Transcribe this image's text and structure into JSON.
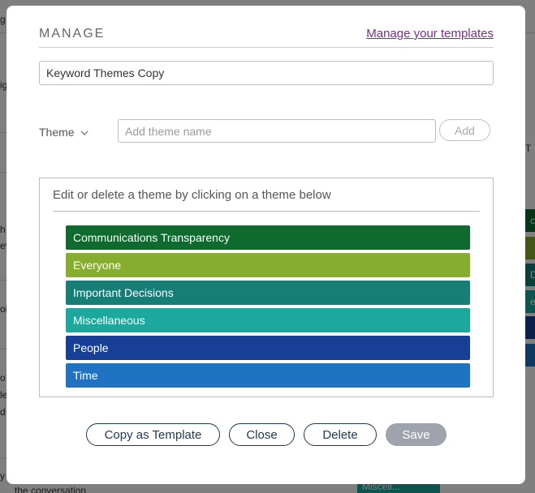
{
  "modal": {
    "title": "MANAGE",
    "manage_link": "Manage your templates",
    "template_name_value": "Keyword Themes Copy",
    "theme_label": "Theme",
    "theme_name_placeholder": "Add theme name",
    "add_label": "Add",
    "themes_instruction": "Edit or delete a theme by clicking on a theme below",
    "themes": [
      {
        "name": "Communications Transparency",
        "color": "#0e6a2f"
      },
      {
        "name": "Everyone",
        "color": "#86ad2e"
      },
      {
        "name": "Important Decisions",
        "color": "#177e76"
      },
      {
        "name": "Miscellaneous",
        "color": "#1ca89d"
      },
      {
        "name": "People",
        "color": "#173f95"
      },
      {
        "name": "Time",
        "color": "#1f73c0"
      }
    ],
    "buttons": {
      "copy_as_template": "Copy as Template",
      "close": "Close",
      "delete": "Delete",
      "save": "Save"
    }
  },
  "background": {
    "texts": [
      "g",
      "ig",
      "h",
      "ev",
      "oi",
      "o",
      "le",
      "d",
      "y",
      "the conversation",
      "ca",
      "D",
      "eo",
      "T"
    ],
    "chip_label": "Miscell..."
  },
  "colors": {
    "link": "#7b2d8e",
    "button_outline": "#1f3655",
    "save_disabled": "#9ea3ae"
  }
}
